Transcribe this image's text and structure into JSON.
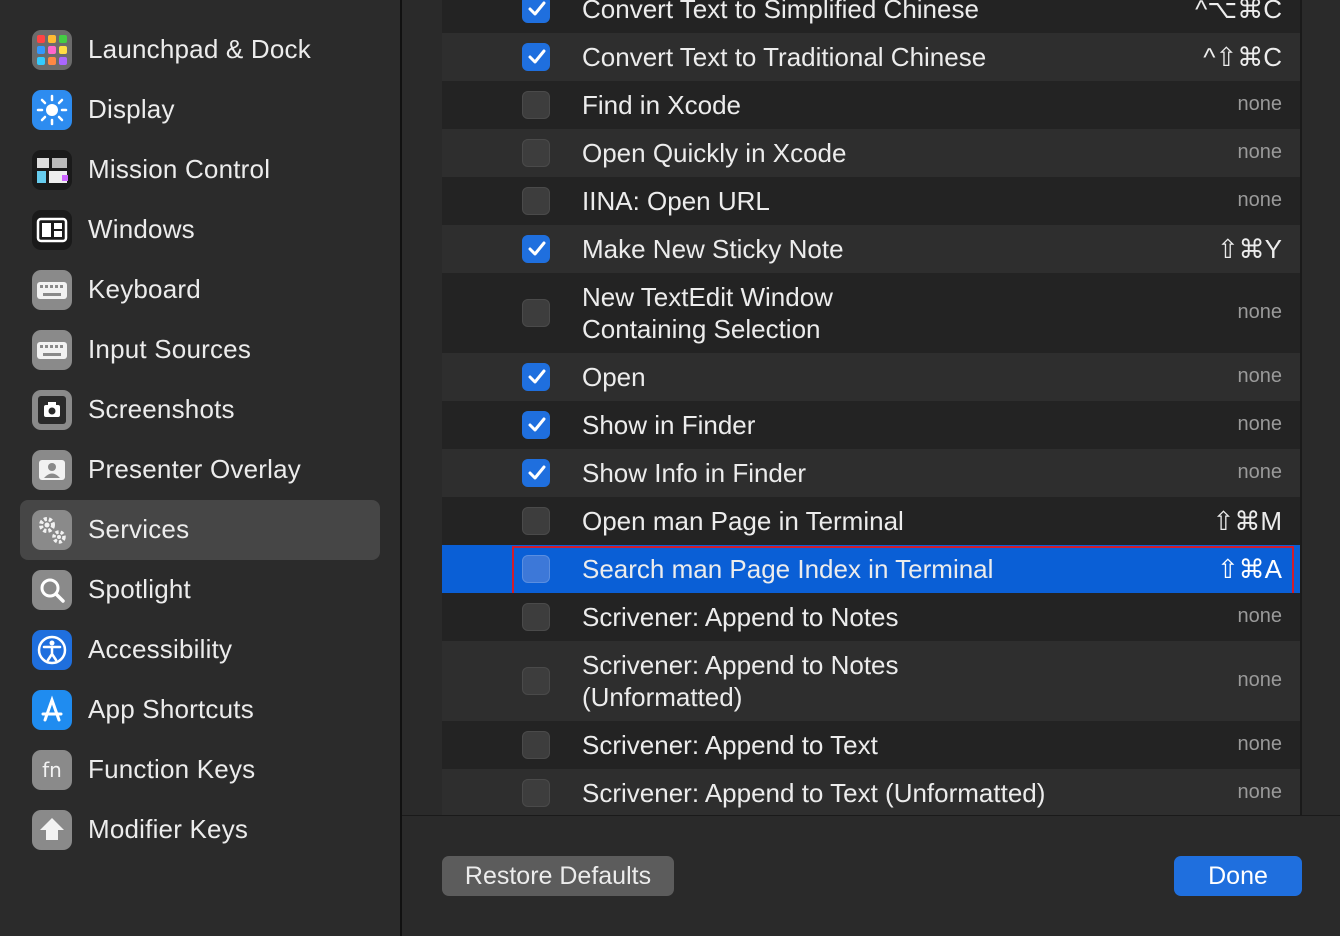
{
  "sidebar": {
    "items": [
      {
        "label": "Launchpad & Dock",
        "icon": "launchpad-icon",
        "selected": false
      },
      {
        "label": "Display",
        "icon": "display-icon",
        "selected": false
      },
      {
        "label": "Mission Control",
        "icon": "mission-control-icon",
        "selected": false
      },
      {
        "label": "Windows",
        "icon": "windows-icon",
        "selected": false
      },
      {
        "label": "Keyboard",
        "icon": "keyboard-icon",
        "selected": false
      },
      {
        "label": "Input Sources",
        "icon": "input-sources-icon",
        "selected": false
      },
      {
        "label": "Screenshots",
        "icon": "screenshots-icon",
        "selected": false
      },
      {
        "label": "Presenter Overlay",
        "icon": "presenter-overlay-icon",
        "selected": false
      },
      {
        "label": "Services",
        "icon": "services-gear-icon",
        "selected": true
      },
      {
        "label": "Spotlight",
        "icon": "spotlight-icon",
        "selected": false
      },
      {
        "label": "Accessibility",
        "icon": "accessibility-icon",
        "selected": false
      },
      {
        "label": "App Shortcuts",
        "icon": "app-shortcuts-icon",
        "selected": false
      },
      {
        "label": "Function Keys",
        "icon": "function-keys-icon",
        "selected": false
      },
      {
        "label": "Modifier Keys",
        "icon": "modifier-keys-icon",
        "selected": false
      }
    ]
  },
  "services": {
    "rows": [
      {
        "label": "Convert Text to Simplified Chinese",
        "checked": true,
        "shortcut": "^⌥⌘C"
      },
      {
        "label": "Convert Text to Traditional Chinese",
        "checked": true,
        "shortcut": "^⇧⌘C"
      },
      {
        "label": "Find in Xcode",
        "checked": false,
        "shortcut": "none"
      },
      {
        "label": "Open Quickly in Xcode",
        "checked": false,
        "shortcut": "none"
      },
      {
        "label": "IINA: Open URL",
        "checked": false,
        "shortcut": "none"
      },
      {
        "label": "Make New Sticky Note",
        "checked": true,
        "shortcut": "⇧⌘Y"
      },
      {
        "label": "New TextEdit Window",
        "label2": "Containing Selection",
        "checked": false,
        "shortcut": "none"
      },
      {
        "label": "Open",
        "checked": true,
        "shortcut": "none"
      },
      {
        "label": "Show in Finder",
        "checked": true,
        "shortcut": "none"
      },
      {
        "label": "Show Info in Finder",
        "checked": true,
        "shortcut": "none"
      },
      {
        "label": "Open man Page in Terminal",
        "checked": false,
        "shortcut": "⇧⌘M"
      },
      {
        "label": "Search man Page Index in Terminal",
        "checked": false,
        "shortcut": "⇧⌘A",
        "selected": true
      },
      {
        "label": "Scrivener: Append to Notes",
        "checked": false,
        "shortcut": "none"
      },
      {
        "label": "Scrivener: Append to Notes",
        "label2": "(Unformatted)",
        "checked": false,
        "shortcut": "none"
      },
      {
        "label": "Scrivener: Append to Text",
        "checked": false,
        "shortcut": "none"
      },
      {
        "label": "Scrivener: Append to Text (Unformatted)",
        "checked": false,
        "shortcut": "none"
      }
    ]
  },
  "footer": {
    "restore_label": "Restore Defaults",
    "done_label": "Done"
  },
  "colors": {
    "accent": "#1f6fde",
    "selection": "#0a5fd6",
    "highlight_outline": "#d21c2c"
  }
}
